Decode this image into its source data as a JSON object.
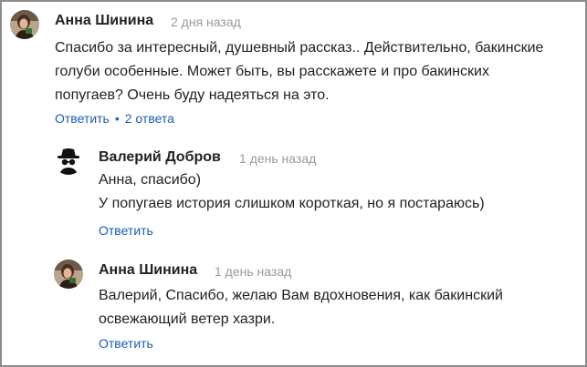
{
  "comments": [
    {
      "author": "Анна Шинина",
      "time": "2 дня назад",
      "lines": [
        "Спасибо за интересный, душевный рассказ.. Действительно, бакинские",
        "голуби особенные. Может быть, вы расскажете и про бакинских",
        "попугаев? Очень буду надеяться на это."
      ],
      "reply_label": "Ответить",
      "replies_count_label": "2 ответа",
      "avatar_icon": "user-photo-avatar"
    },
    {
      "author": "Валерий Добров",
      "time": "1 день назад",
      "lines": [
        "Анна, спасибо)",
        "У попугаев история слишком короткая, но я постараюсь)"
      ],
      "reply_label": "Ответить",
      "avatar_icon": "incognito-avatar"
    },
    {
      "author": "Анна Шинина",
      "time": "1 день назад",
      "lines": [
        "Валерий, Спасибо, желаю Вам вдохновения, как бакинский",
        "освежающий ветер хазри."
      ],
      "reply_label": "Ответить",
      "avatar_icon": "user-photo-avatar"
    }
  ],
  "colors": {
    "link": "#1a5fb4",
    "time": "#9a9a9a",
    "text": "#222222",
    "frame": "#8c8c8c"
  }
}
